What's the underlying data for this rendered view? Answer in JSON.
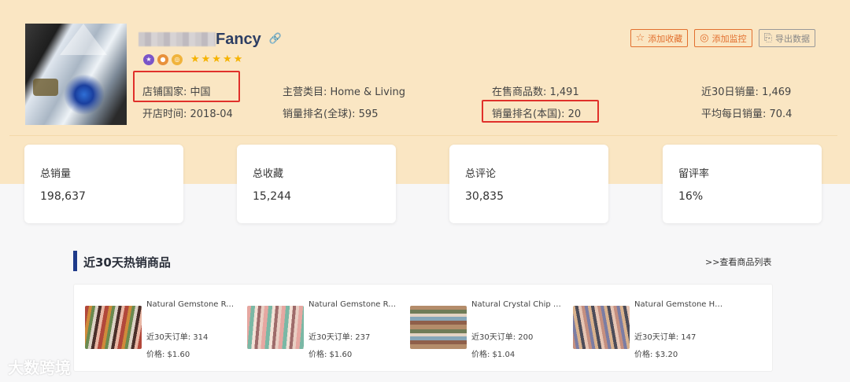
{
  "shop": {
    "name": "Fancy",
    "stars": "★★★★★",
    "photo_alt": "shop-crystal-photo"
  },
  "actions": {
    "favorite": "添加收藏",
    "monitor": "添加监控",
    "export": "导出数据"
  },
  "info": {
    "country": "店铺国家: 中国",
    "opened": "开店时间: 2018-04",
    "category": "主营类目: Home & Living",
    "rank_global": "销量排名(全球): 595",
    "on_sale": "在售商品数: 1,491",
    "rank_local": "销量排名(本国): 20",
    "sales_30d": "近30日销量: 1,469",
    "avg_daily": "平均每日销量: 70.4"
  },
  "stats": [
    {
      "label": "总销量",
      "value": "198,637"
    },
    {
      "label": "总收藏",
      "value": "15,244"
    },
    {
      "label": "总评论",
      "value": "30,835"
    },
    {
      "label": "留评率",
      "value": "16%"
    }
  ],
  "section": {
    "title": "近30天热销商品",
    "link": ">>查看商品列表"
  },
  "products": [
    {
      "name": "Natural Gemstone Round Bead Bracelet",
      "orders": "近30天订单: 314",
      "price": "价格: $1.60"
    },
    {
      "name": "Natural Gemstone Round Bead Strand",
      "orders": "近30天订单: 237",
      "price": "价格: $1.60"
    },
    {
      "name": "Natural Crystal Chip Stone Bracelet",
      "orders": "近30天订单: 200",
      "price": "价格: $1.04"
    },
    {
      "name": "Natural Gemstone Heishi Beads",
      "orders": "近30天订单: 147",
      "price": "价格: $3.20"
    }
  ],
  "watermark": "大数跨境",
  "colors": {
    "band": "#fae6c3",
    "accent": "#e2702f",
    "highlight": "#e0302a",
    "title_blue": "#2d3e63"
  }
}
